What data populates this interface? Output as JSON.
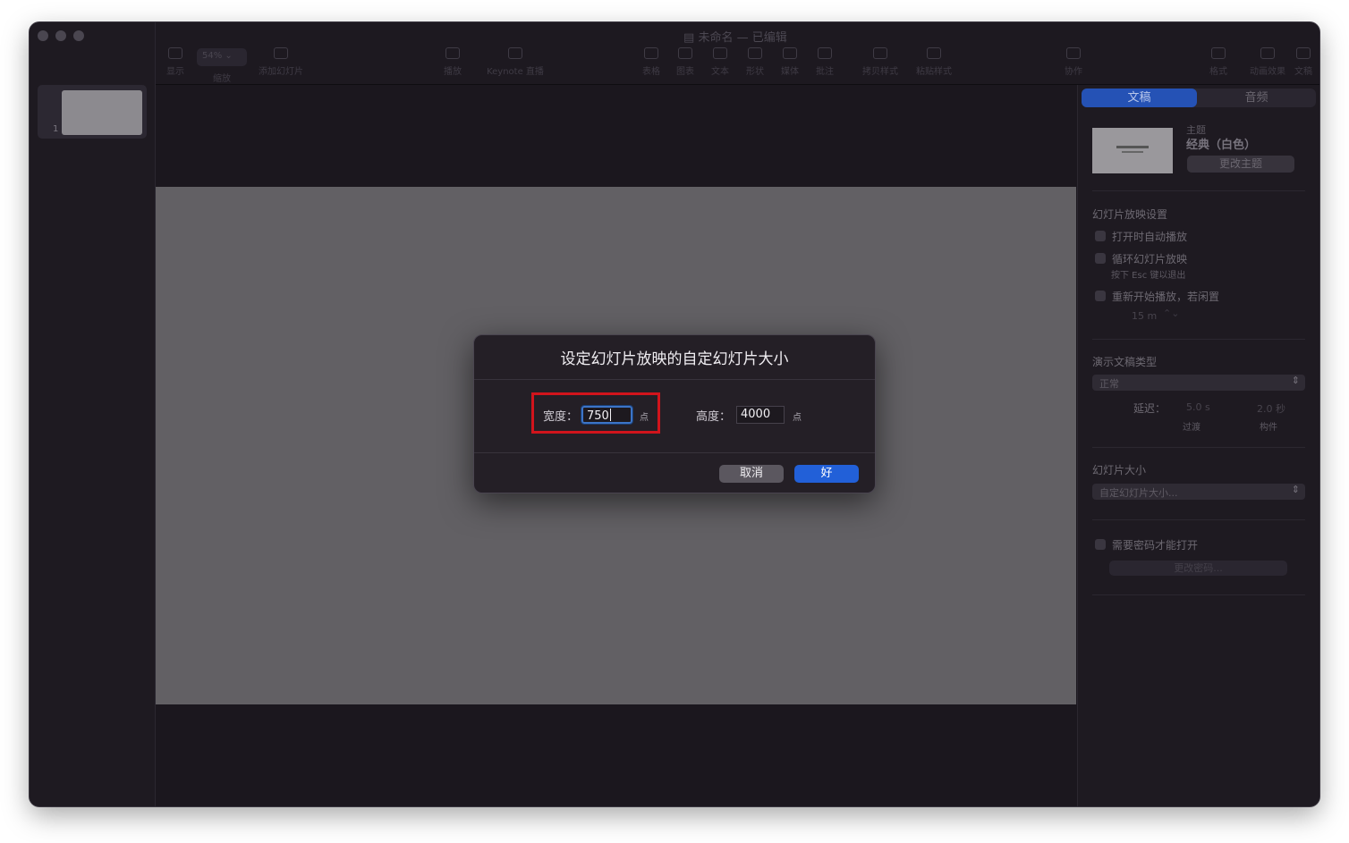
{
  "window": {
    "title": "未命名 — 已编辑"
  },
  "toolbar": {
    "zoom_value": "54%",
    "items": [
      {
        "label": "显示",
        "icon": "view-icon"
      },
      {
        "label": "缩放",
        "icon": "zoom-icon"
      },
      {
        "label": "添加幻灯片",
        "icon": "add-slide-icon"
      },
      {
        "label": "播放",
        "icon": "play-icon"
      },
      {
        "label": "Keynote 直播",
        "icon": "keynote-live-icon"
      },
      {
        "label": "表格",
        "icon": "table-icon"
      },
      {
        "label": "图表",
        "icon": "chart-icon"
      },
      {
        "label": "文本",
        "icon": "text-icon"
      },
      {
        "label": "形状",
        "icon": "shape-icon"
      },
      {
        "label": "媒体",
        "icon": "media-icon"
      },
      {
        "label": "批注",
        "icon": "comment-icon"
      },
      {
        "label": "拷贝样式",
        "icon": "copy-style-icon"
      },
      {
        "label": "粘贴样式",
        "icon": "paste-style-icon"
      },
      {
        "label": "协作",
        "icon": "collaborate-icon"
      },
      {
        "label": "格式",
        "icon": "format-icon"
      },
      {
        "label": "动画效果",
        "icon": "animate-icon"
      },
      {
        "label": "文稿",
        "icon": "document-icon"
      }
    ]
  },
  "navigator": {
    "slide_number": "1"
  },
  "inspector": {
    "tabs": [
      "文稿",
      "音频"
    ],
    "theme_label": "主题",
    "theme_name": "经典（白色）",
    "change_theme": "更改主题",
    "slideshow_heading": "幻灯片放映设置",
    "autoplay": "打开时自动播放",
    "loop": "循环幻灯片放映",
    "esc_hint": "按下 Esc 键以退出",
    "restart": "重新开始播放，若闲置",
    "idle_value": "15 m",
    "presentation_type_heading": "演示文稿类型",
    "presentation_type": "正常",
    "delay_label": "延迟：",
    "transition_delay": "5.0 s",
    "build_delay": "2.0 秒",
    "transition_label": "过渡",
    "build_label": "构件",
    "slide_size_heading": "幻灯片大小",
    "slide_size": "自定幻灯片大小...",
    "password": "需要密码才能打开",
    "change_password": "更改密码..."
  },
  "dialog": {
    "title": "设定幻灯片放映的自定幻灯片大小",
    "width_label": "宽度：",
    "width_value": "750",
    "height_label": "高度：",
    "height_value": "4000",
    "unit": "点",
    "cancel": "取消",
    "ok": "好"
  },
  "colors": {
    "accent": "#2260d8",
    "highlight": "#d1141c"
  }
}
